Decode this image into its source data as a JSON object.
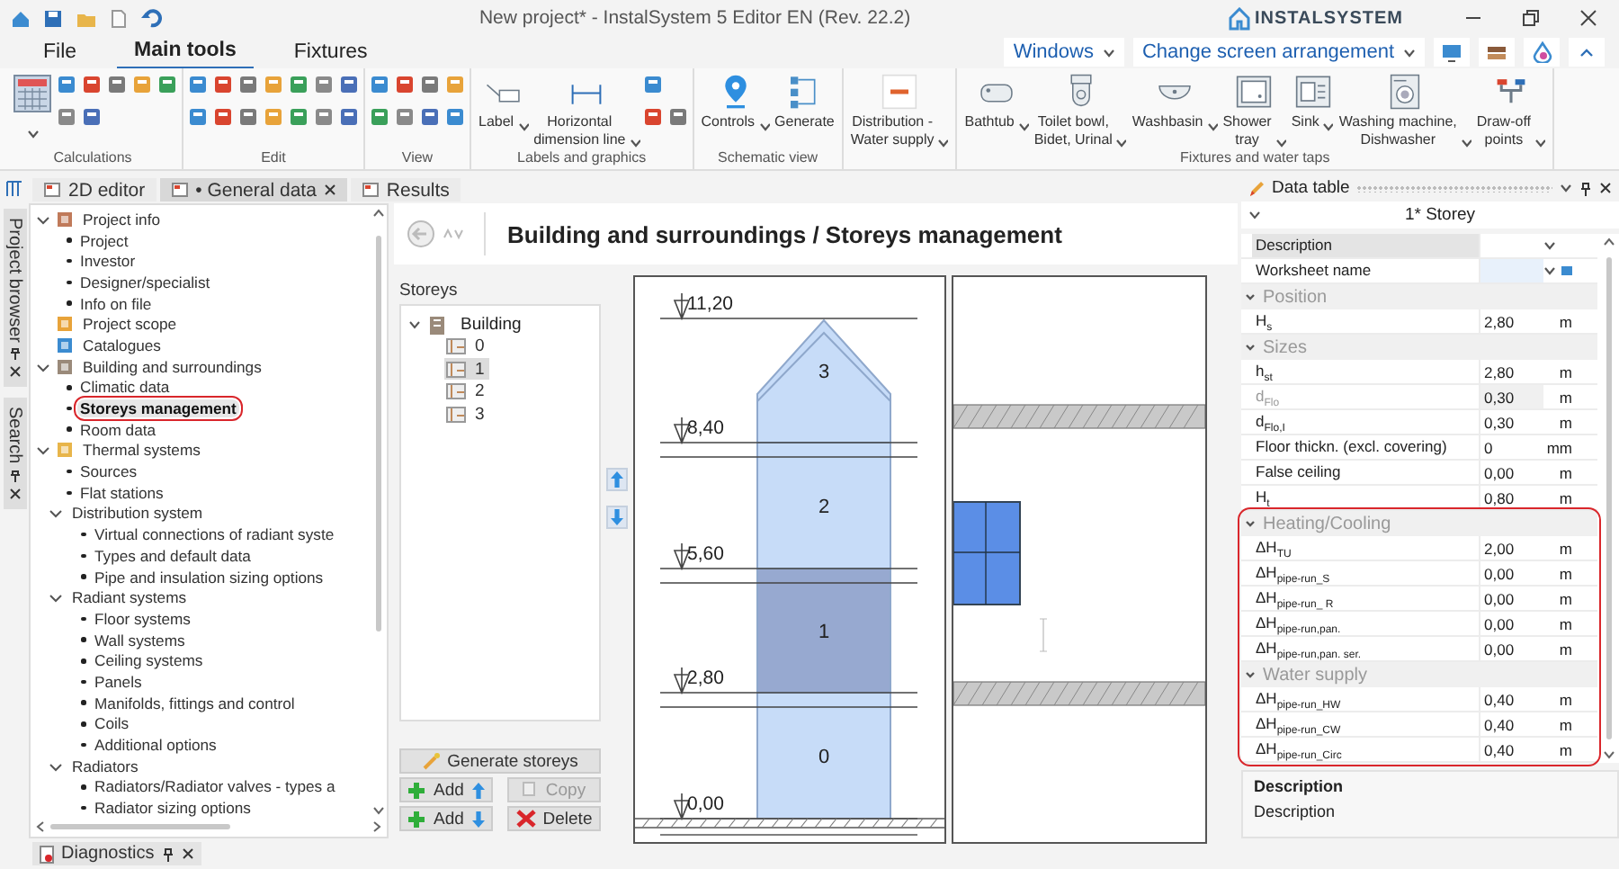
{
  "window": {
    "title": "New project* - InstalSystem 5 Editor EN (Rev. 22.2)",
    "logo": "INSTALSYSTEM"
  },
  "menu_tabs": [
    {
      "label": "File",
      "selected": false
    },
    {
      "label": "Main tools",
      "selected": true
    },
    {
      "label": "Fixtures",
      "selected": false
    }
  ],
  "top_right": {
    "windows": "Windows",
    "arrangement": "Change screen arrangement"
  },
  "ribbon_groups": [
    {
      "label": "Calculations",
      "kind": "calculations"
    },
    {
      "label": "Edit",
      "kind": "edit"
    },
    {
      "label": "View",
      "kind": "view"
    },
    {
      "label": "Labels and graphics",
      "kind": "labels",
      "buttons": [
        {
          "label": "Label",
          "kind": "label",
          "dropdown": true
        },
        {
          "label": "Horizontal\ndimension line",
          "kind": "dimension",
          "dropdown": true
        }
      ]
    },
    {
      "label": "Schematic view",
      "kind": "plain",
      "buttons": [
        {
          "label": "Controls",
          "kind": "pin",
          "dropdown": true
        },
        {
          "label": "Generate",
          "kind": "generate",
          "dropdown": false
        }
      ]
    },
    {
      "kind": "plain",
      "buttons": [
        {
          "label": "Distribution -\nWater supply",
          "kind": "distribution",
          "dropdown": true
        }
      ]
    },
    {
      "label": "Fixtures and water taps",
      "kind": "plain",
      "buttons": [
        {
          "label": "Bathtub",
          "kind": "bathtub",
          "dropdown": true
        },
        {
          "label": "Toilet bowl,\nBidet, Urinal",
          "kind": "toilet",
          "dropdown": true
        },
        {
          "label": "Washbasin",
          "kind": "washbasin",
          "dropdown": true
        },
        {
          "label": "Shower\ntray",
          "kind": "shower",
          "dropdown": true
        },
        {
          "label": "Sink",
          "kind": "sink",
          "dropdown": true
        },
        {
          "label": "Washing machine,\nDishwasher",
          "kind": "washer",
          "dropdown": true
        },
        {
          "label": "Draw-off\npoints",
          "kind": "tap",
          "dropdown": true
        }
      ]
    }
  ],
  "side_tabs": [
    "Project browser",
    "Search"
  ],
  "doc_tabs": [
    {
      "label": "2D editor",
      "selected": false,
      "closable": false
    },
    {
      "label": "• General data",
      "selected": true,
      "closable": true
    },
    {
      "label": "Results",
      "selected": false,
      "closable": false
    }
  ],
  "project_tree": [
    {
      "label": "Project info",
      "selected": false,
      "expanded": true,
      "children": [
        {
          "label": "Project",
          "selected": false
        },
        {
          "label": "Investor",
          "selected": false
        },
        {
          "label": "Designer/specialist",
          "selected": false
        },
        {
          "label": "Info on file",
          "selected": false
        }
      ]
    },
    {
      "label": "Project scope",
      "selected": false
    },
    {
      "label": "Catalogues",
      "selected": false
    },
    {
      "label": "Building and surroundings",
      "selected": false,
      "expanded": true,
      "children": [
        {
          "label": "Climatic data",
          "selected": false
        },
        {
          "label": "Storeys management",
          "selected": true
        },
        {
          "label": "Room data",
          "selected": false
        }
      ]
    },
    {
      "label": "Thermal systems",
      "selected": false,
      "expanded": true,
      "children": [
        {
          "label": "Sources",
          "selected": false
        },
        {
          "label": "Flat stations",
          "selected": false
        },
        {
          "label": "Distribution system",
          "selected": false,
          "expanded": true,
          "children": [
            {
              "label": "Virtual connections of radiant syste",
              "selected": false
            },
            {
              "label": "Types and default data",
              "selected": false
            },
            {
              "label": "Pipe and insulation sizing options",
              "selected": false
            }
          ]
        },
        {
          "label": "Radiant systems",
          "selected": false,
          "expanded": true,
          "children": [
            {
              "label": "Floor systems",
              "selected": false
            },
            {
              "label": "Wall systems",
              "selected": false
            },
            {
              "label": "Ceiling systems",
              "selected": false
            },
            {
              "label": "Panels",
              "selected": false
            },
            {
              "label": "Manifolds, fittings and control",
              "selected": false
            },
            {
              "label": "Coils",
              "selected": false
            },
            {
              "label": "Additional options",
              "selected": false
            }
          ]
        },
        {
          "label": "Radiators",
          "selected": false,
          "expanded": true,
          "children": [
            {
              "label": "Radiators/Radiator valves - types a",
              "selected": false
            },
            {
              "label": "Radiator sizing options",
              "selected": false
            }
          ]
        }
      ]
    }
  ],
  "page": {
    "title": "Building and surroundings / Storeys management",
    "storeys_label": "Storeys",
    "storeys_tree": {
      "label": "Building",
      "expanded": true,
      "children": [
        {
          "label": "0",
          "selected": false
        },
        {
          "label": "1",
          "selected": true
        },
        {
          "label": "2",
          "selected": false
        },
        {
          "label": "3",
          "selected": false
        }
      ]
    },
    "buttons": [
      {
        "label": "Generate storeys",
        "kind": "generate",
        "disabled": false
      },
      {
        "label": "Add",
        "kind": "add-up",
        "disabled": false
      },
      {
        "label": "Copy",
        "kind": "copy",
        "disabled": true
      },
      {
        "label": "Add",
        "kind": "add-down",
        "disabled": false
      },
      {
        "label": "Delete",
        "kind": "delete",
        "disabled": false
      }
    ],
    "elevations": [
      "11,20",
      "8,40",
      "5,60",
      "2,80",
      "0,00"
    ],
    "storeys": [
      {
        "label": "3",
        "selected": false
      },
      {
        "label": "2",
        "selected": false
      },
      {
        "label": "1",
        "selected": true
      },
      {
        "label": "0",
        "selected": false
      }
    ]
  },
  "data_table": {
    "title": "Data table",
    "subtitle": "1* Storey",
    "top_rows": [
      {
        "name": "Description",
        "selected": true
      },
      {
        "name": "Worksheet name",
        "selected": false
      }
    ],
    "sections": [
      {
        "title": "Position",
        "expanded": true,
        "highlighted": false,
        "rows": [
          {
            "name": "H$_{s}$",
            "value": "2,80",
            "unit": "m",
            "disabled": false
          }
        ]
      },
      {
        "title": "Sizes",
        "expanded": true,
        "highlighted": false,
        "rows": [
          {
            "name": "h$_{st}$",
            "value": "2,80",
            "unit": "m",
            "disabled": false
          },
          {
            "name": "d$_{Flo}$",
            "value": "0,30",
            "unit": "m",
            "disabled": true
          },
          {
            "name": "d$_{Flo,I}$",
            "value": "0,30",
            "unit": "m",
            "disabled": false
          },
          {
            "name": "Floor thickn. (excl. covering)",
            "value": "0",
            "unit": "mm",
            "disabled": false
          },
          {
            "name": "False ceiling",
            "value": "0,00",
            "unit": "m",
            "disabled": false
          },
          {
            "name": "H$_{t}$",
            "value": "0,80",
            "unit": "m",
            "disabled": false
          }
        ]
      },
      {
        "title": "Heating/Cooling",
        "expanded": true,
        "highlighted": true,
        "rows": [
          {
            "name": "ΔH$_{TU}$",
            "value": "2,00",
            "unit": "m",
            "disabled": false
          },
          {
            "name": "ΔH$_{pipe-run_S}$",
            "value": "0,00",
            "unit": "m",
            "disabled": false
          },
          {
            "name": "ΔH$_{pipe-run_ R}$",
            "value": "0,00",
            "unit": "m",
            "disabled": false
          },
          {
            "name": "ΔH$_{pipe-run,pan.}$",
            "value": "0,00",
            "unit": "m",
            "disabled": false
          },
          {
            "name": "ΔH$_{pipe-run,pan. ser.}$",
            "value": "0,00",
            "unit": "m",
            "disabled": false
          }
        ]
      },
      {
        "title": "Water supply",
        "expanded": true,
        "highlighted": true,
        "rows": [
          {
            "name": "ΔH$_{pipe-run_HW}$",
            "value": "0,40",
            "unit": "m",
            "disabled": false
          },
          {
            "name": "ΔH$_{pipe-run_CW}$",
            "value": "0,40",
            "unit": "m",
            "disabled": false
          },
          {
            "name": "ΔH$_{pipe-run_Circ}$",
            "value": "0,40",
            "unit": "m",
            "disabled": false
          }
        ]
      }
    ],
    "description": {
      "title": "Description",
      "text": "Description"
    }
  },
  "bottom_tabs": [
    "Diagnostics"
  ]
}
